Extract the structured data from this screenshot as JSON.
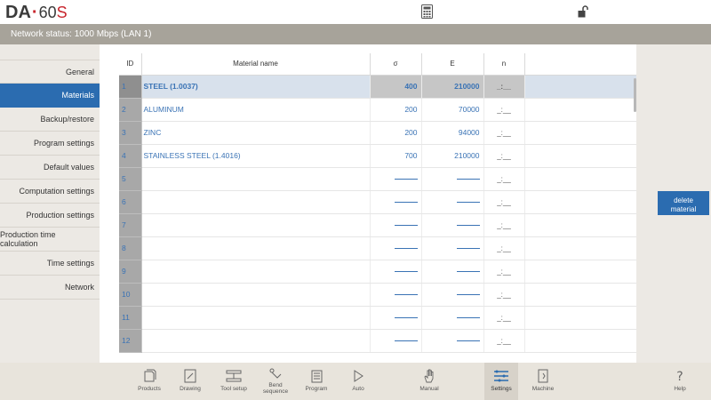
{
  "app": {
    "logo_brand": "DA",
    "logo_model": "60",
    "logo_suffix": "S"
  },
  "status": {
    "network": "Network status: 1000 Mbps (LAN 1)"
  },
  "sidebar": {
    "items": [
      {
        "label": "General"
      },
      {
        "label": "Materials"
      },
      {
        "label": "Backup/restore"
      },
      {
        "label": "Program settings"
      },
      {
        "label": "Default values"
      },
      {
        "label": "Computation settings"
      },
      {
        "label": "Production settings"
      },
      {
        "label": "Production time calculation"
      },
      {
        "label": "Time settings"
      },
      {
        "label": "Network"
      }
    ],
    "active": "Materials"
  },
  "table": {
    "headers": {
      "id": "ID",
      "name": "Material name",
      "sigma": "σ",
      "e": "E",
      "n": "n"
    },
    "rows": [
      {
        "id": "1",
        "name": "STEEL (1.0037)",
        "sigma": "400",
        "e": "210000",
        "n": "_:__"
      },
      {
        "id": "2",
        "name": "ALUMINUM",
        "sigma": "200",
        "e": "70000",
        "n": "_:__"
      },
      {
        "id": "3",
        "name": "ZINC",
        "sigma": "200",
        "e": "94000",
        "n": "_:__"
      },
      {
        "id": "4",
        "name": "STAINLESS STEEL (1.4016)",
        "sigma": "700",
        "e": "210000",
        "n": "_:__"
      },
      {
        "id": "5",
        "name": "",
        "sigma": "",
        "e": "",
        "n": "_:__"
      },
      {
        "id": "6",
        "name": "",
        "sigma": "",
        "e": "",
        "n": "_:__"
      },
      {
        "id": "7",
        "name": "",
        "sigma": "",
        "e": "",
        "n": "_:__"
      },
      {
        "id": "8",
        "name": "",
        "sigma": "",
        "e": "",
        "n": "_:__"
      },
      {
        "id": "9",
        "name": "",
        "sigma": "",
        "e": "",
        "n": "_:__"
      },
      {
        "id": "10",
        "name": "",
        "sigma": "",
        "e": "",
        "n": "_:__"
      },
      {
        "id": "11",
        "name": "",
        "sigma": "",
        "e": "",
        "n": "_:__"
      },
      {
        "id": "12",
        "name": "",
        "sigma": "",
        "e": "",
        "n": "_:__"
      }
    ],
    "selected_id": "1"
  },
  "actions": {
    "delete_label_1": "delete",
    "delete_label_2": "material"
  },
  "bottomnav": {
    "products": "Products",
    "drawing": "Drawing",
    "tool_setup": "Tool setup",
    "bend_1": "Bend",
    "bend_2": "sequence",
    "program": "Program",
    "auto": "Auto",
    "manual": "Manual",
    "settings": "Settings",
    "machine": "Machine",
    "help": "Help",
    "active": "Settings"
  },
  "colors": {
    "accent": "#2b6cb0",
    "statusbar": "#a7a39a",
    "logo_red": "#c8262d"
  }
}
